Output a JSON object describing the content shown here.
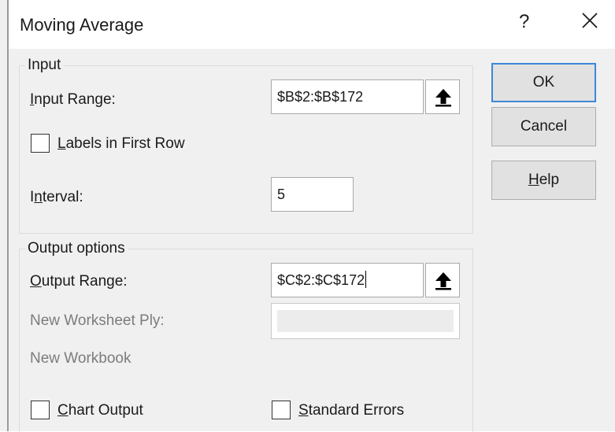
{
  "dialog": {
    "title": "Moving Average",
    "help_glyph": "?",
    "close_icon": "close-icon"
  },
  "input_group": {
    "label": "Input",
    "input_range_label": {
      "before": "",
      "mnemonic": "I",
      "after": "nput Range:"
    },
    "input_range_value": "$B$2:$B$172",
    "labels_first_row": {
      "before": "",
      "mnemonic": "L",
      "after": "abels in First Row",
      "checked": false
    },
    "interval_label": {
      "before": "I",
      "mnemonic": "n",
      "after": "terval:"
    },
    "interval_value": "5"
  },
  "output_group": {
    "label": "Output options",
    "output_range_label": {
      "before": "",
      "mnemonic": "O",
      "after": "utput Range:"
    },
    "output_range_value": "$C$2:$C$172",
    "new_worksheet_label": "New Worksheet Ply:",
    "new_worksheet_value": "",
    "new_workbook_label": "New Workbook",
    "chart_output": {
      "before": "",
      "mnemonic": "C",
      "after": "hart Output",
      "checked": false
    },
    "standard_errors": {
      "before": "",
      "mnemonic": "S",
      "after": "tandard Errors",
      "checked": false
    }
  },
  "buttons": {
    "ok": "OK",
    "cancel": "Cancel",
    "help": {
      "before": "",
      "mnemonic": "H",
      "after": "elp"
    }
  },
  "colors": {
    "dialog_bg": "#f0f0f0",
    "titlebar_bg": "#ffffff",
    "default_button_border": "#3d87d6",
    "disabled_text": "#7c7c7c"
  },
  "icons": {
    "range_selector": "arrow-up-icon"
  }
}
